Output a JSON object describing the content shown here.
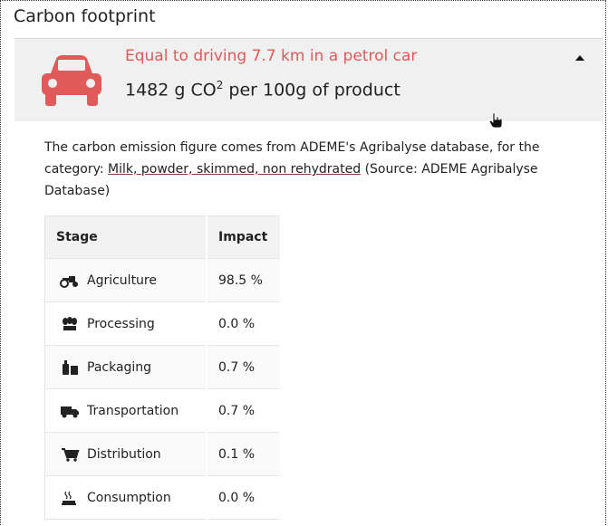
{
  "title": "Carbon footprint",
  "summary": {
    "equivalent": "Equal to driving 7.7 km in a petrol car",
    "co2_prefix": "1482 g CO",
    "co2_sup": "2",
    "co2_suffix": " per 100g of product",
    "icon": "car-icon",
    "accent": "#e05a5a"
  },
  "description": {
    "text_before": "The carbon emission figure comes from ADEME's Agribalyse database, for the category: ",
    "link": "Milk, powder, skimmed, non rehydrated",
    "text_after": " (Source: ADEME Agribalyse Database)"
  },
  "table": {
    "headers": {
      "stage": "Stage",
      "impact": "Impact"
    },
    "rows": [
      {
        "stage": "Agriculture",
        "impact": "98.5 %",
        "icon": "tractor-icon"
      },
      {
        "stage": "Processing",
        "impact": "0.0 %",
        "icon": "grain-icon"
      },
      {
        "stage": "Packaging",
        "impact": "0.7 %",
        "icon": "bottle-icon"
      },
      {
        "stage": "Transportation",
        "impact": "0.7 %",
        "icon": "truck-icon"
      },
      {
        "stage": "Distribution",
        "impact": "0.1 %",
        "icon": "cart-icon"
      },
      {
        "stage": "Consumption",
        "impact": "0.0 %",
        "icon": "cooking-icon"
      }
    ]
  }
}
